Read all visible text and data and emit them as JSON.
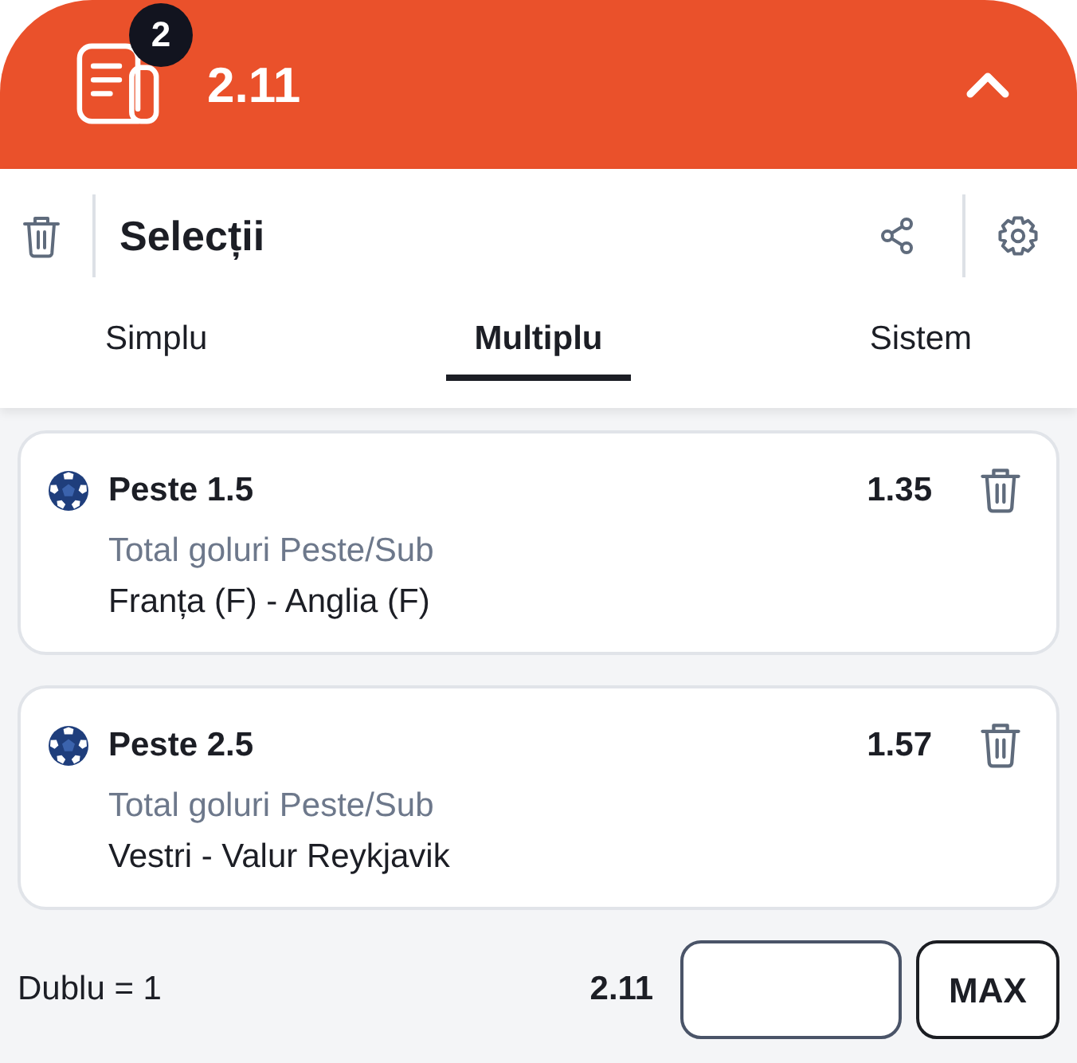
{
  "header": {
    "badge": "2",
    "total_odds": "2.11",
    "expanded": true
  },
  "toolbar": {
    "title": "Selecții"
  },
  "tabs": [
    {
      "label": "Simplu",
      "selected": false
    },
    {
      "label": "Multiplu",
      "selected": true
    },
    {
      "label": "Sistem",
      "selected": false
    }
  ],
  "selections": [
    {
      "pick": "Peste 1.5",
      "odds": "1.35",
      "market": "Total goluri Peste/Sub",
      "event": "Franța (F) - Anglia (F)"
    },
    {
      "pick": "Peste 2.5",
      "odds": "1.57",
      "market": "Total goluri Peste/Sub",
      "event": "Vestri - Valur Reykjavik"
    }
  ],
  "footer": {
    "combination": "Dublu = 1",
    "total_odds": "2.11",
    "max_button": "MAX"
  }
}
